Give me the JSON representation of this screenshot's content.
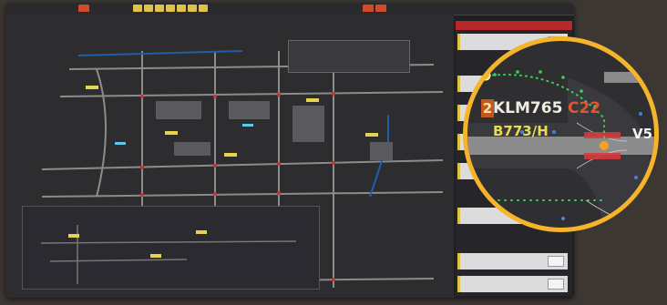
{
  "lens": {
    "sequence": "2",
    "callsign": "KLM765",
    "gate": "C22",
    "aircraft_type": "B773/H",
    "stand": "V5",
    "partial_value": "4.0"
  },
  "colors": {
    "lens_border": "#f5b42a",
    "taxi_route": "#3ad05a",
    "stop_bar": "#e03030",
    "accent_orange": "#f5a020"
  }
}
